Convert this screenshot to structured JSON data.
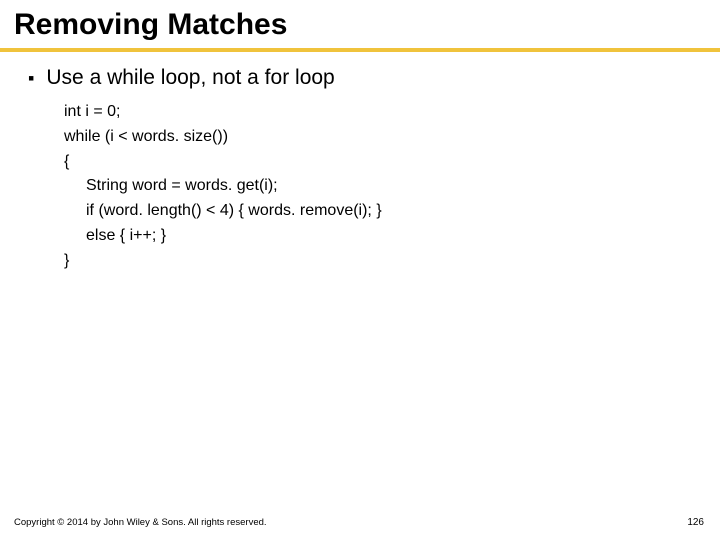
{
  "title": "Removing Matches",
  "bullet": "Use a while loop, not a for loop",
  "code": {
    "l1": "int i = 0;",
    "l2": "while (i < words. size())",
    "l3": "{",
    "l4": "String word = words. get(i);",
    "l5": "if (word. length() < 4) { words. remove(i); }",
    "l6": "else { i++; }",
    "l7": "}"
  },
  "footer": "Copyright © 2014 by John Wiley & Sons. All rights reserved.",
  "page_number": "126"
}
